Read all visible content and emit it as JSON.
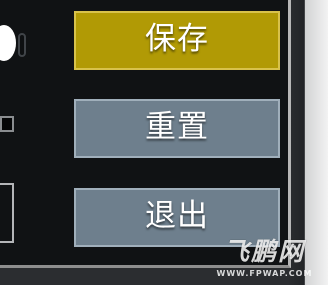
{
  "menu": {
    "save_label": "保存",
    "reset_label": "重置",
    "exit_label": "退出"
  },
  "watermark": {
    "text": "飞鹏网",
    "url": "WWW.FPWAP.COM"
  },
  "colors": {
    "panel_background": "#101214",
    "save_button": "#b19a05",
    "secondary_button": "#6e7f8d",
    "button_text": "#ffffff"
  }
}
